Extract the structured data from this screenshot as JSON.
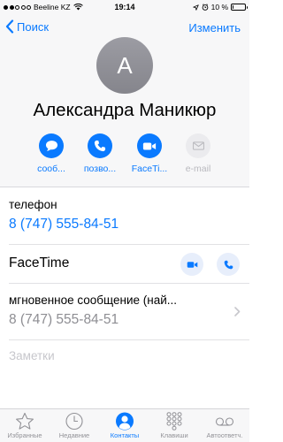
{
  "status_bar": {
    "carrier": "Beeline KZ",
    "time": "19:14",
    "battery_percent": "10 %",
    "battery_level": 0.1
  },
  "nav": {
    "back_label": "Поиск",
    "edit_label": "Изменить"
  },
  "contact": {
    "initial": "A",
    "name": "Александра Маникюр"
  },
  "actions": [
    {
      "label": "сооб...",
      "icon": "message-icon",
      "enabled": true
    },
    {
      "label": "позво...",
      "icon": "phone-icon",
      "enabled": true
    },
    {
      "label": "FaceTi...",
      "icon": "video-icon",
      "enabled": true
    },
    {
      "label": "e-mail",
      "icon": "mail-icon",
      "enabled": false
    }
  ],
  "phone": {
    "label": "телефон",
    "value": "8 (747) 555-84-51"
  },
  "facetime": {
    "label": "FaceTime"
  },
  "im": {
    "label": "мгновенное сообщение (най...",
    "value": "8 (747) 555-84-51"
  },
  "notes": {
    "placeholder": "Заметки"
  },
  "tabs": [
    {
      "label": "Избранные",
      "icon": "star-icon",
      "active": false
    },
    {
      "label": "Недавние",
      "icon": "clock-icon",
      "active": false
    },
    {
      "label": "Контакты",
      "icon": "person-icon",
      "active": true
    },
    {
      "label": "Клавиши",
      "icon": "keypad-icon",
      "active": false
    },
    {
      "label": "Автоответч.",
      "icon": "voicemail-icon",
      "active": false
    }
  ],
  "colors": {
    "accent": "#0a7aff",
    "avatar": "#8e8e93",
    "disabled": "#b9b9be",
    "secondary_text": "#8e8e93"
  }
}
